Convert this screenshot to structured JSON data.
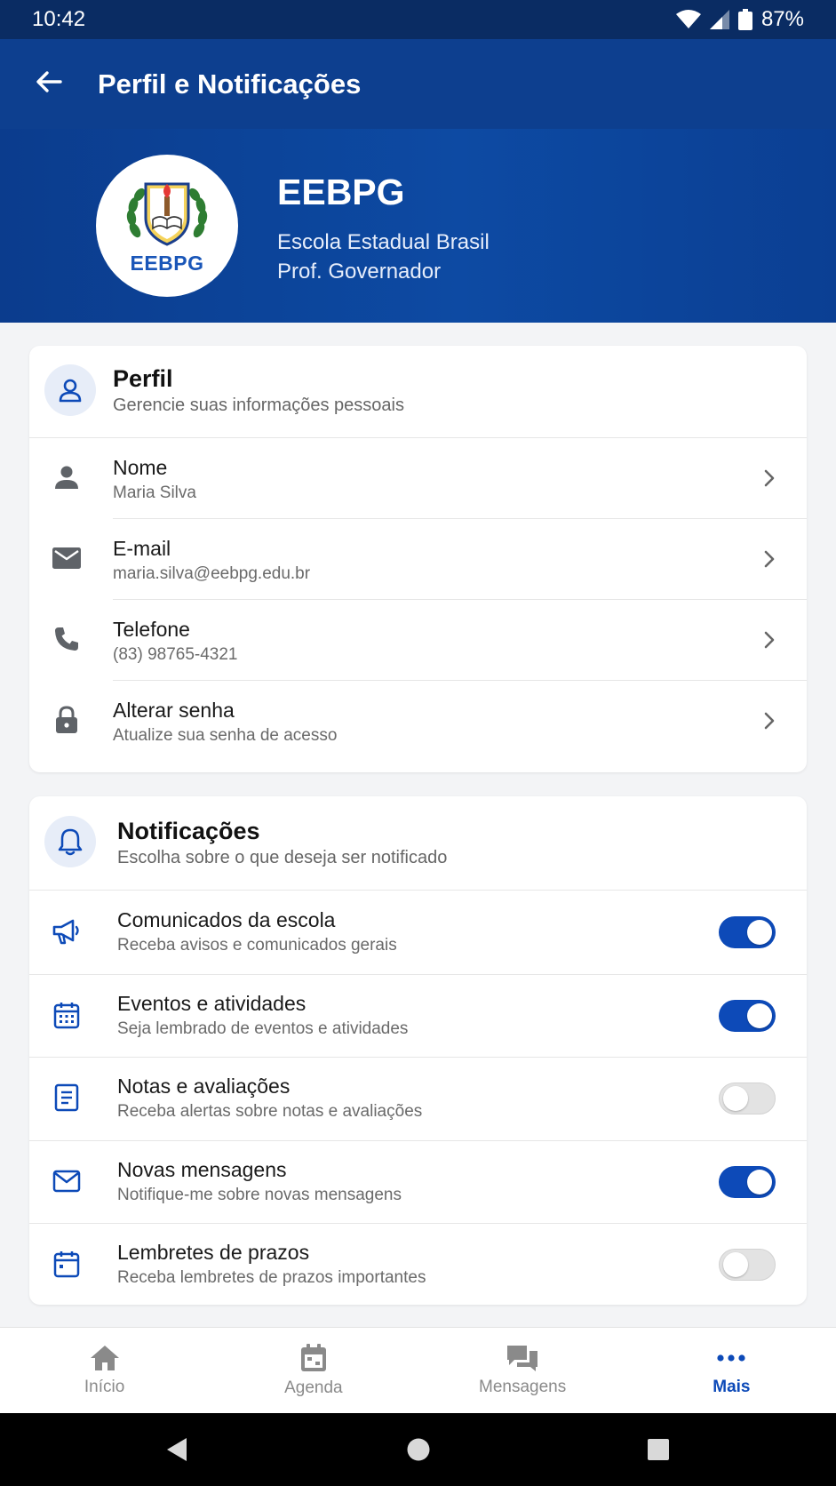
{
  "status_bar": {
    "time": "10:42",
    "battery": "87%"
  },
  "app_bar": {
    "title": "Perfil e Notificações",
    "back_icon": "arrow-left-icon"
  },
  "school": {
    "acronym": "EEBPG",
    "logo_text": "EEBPG",
    "name_line1": "Escola Estadual Brasil",
    "name_line2": "Prof. Governador"
  },
  "profile": {
    "title": "Perfil",
    "subtitle": "Gerencie suas informações pessoais",
    "items": [
      {
        "label": "Nome",
        "value": "Maria Silva",
        "icon": "person-icon"
      },
      {
        "label": "E-mail",
        "value": "maria.silva@eebpg.edu.br",
        "icon": "mail-icon"
      },
      {
        "label": "Telefone",
        "value": "(83) 98765-4321",
        "icon": "phone-icon"
      },
      {
        "label": "Alterar senha",
        "value": "Atualize sua senha de acesso",
        "icon": "lock-icon"
      }
    ]
  },
  "notifications": {
    "title": "Notificações",
    "subtitle": "Escolha sobre o que deseja ser notificado",
    "items": [
      {
        "label": "Comunicados da escola",
        "desc": "Receba avisos e comunicados gerais",
        "enabled": true,
        "icon": "megaphone-icon"
      },
      {
        "label": "Eventos e atividades",
        "desc": "Seja lembrado de eventos e atividades",
        "enabled": true,
        "icon": "calendar-grid-icon"
      },
      {
        "label": "Notas e avaliações",
        "desc": "Receba alertas sobre notas e avaliações",
        "enabled": false,
        "icon": "document-icon"
      },
      {
        "label": "Novas mensagens",
        "desc": "Notifique-me sobre novas mensagens",
        "enabled": true,
        "icon": "envelope-icon"
      },
      {
        "label": "Lembretes de prazos",
        "desc": "Receba lembretes de prazos importantes",
        "enabled": false,
        "icon": "calendar-icon"
      }
    ]
  },
  "bottom_nav": {
    "items": [
      {
        "label": "Início",
        "icon": "home-icon",
        "active": false
      },
      {
        "label": "Agenda",
        "icon": "calendar-icon",
        "active": false
      },
      {
        "label": "Mensagens",
        "icon": "chat-icon",
        "active": false
      },
      {
        "label": "Mais",
        "icon": "more-icon",
        "active": true
      }
    ]
  },
  "colors": {
    "primary": "#0d4ab8",
    "app_bar": "#0d3f8f",
    "status_bar": "#0a2c63"
  }
}
